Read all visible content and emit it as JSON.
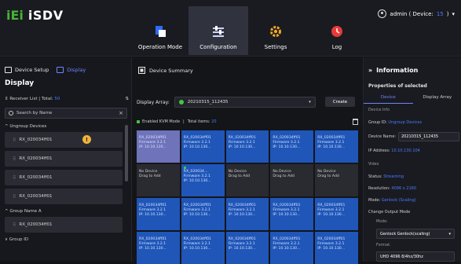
{
  "app": {
    "logo_mark": "iEi",
    "logo_text": "iSDV"
  },
  "nav": [
    {
      "label": "Operation Mode",
      "icon": "operation-mode-icon"
    },
    {
      "label": "Configuration",
      "icon": "configuration-icon"
    },
    {
      "label": "Settings",
      "icon": "gear-icon"
    },
    {
      "label": "Log",
      "icon": "log-icon"
    }
  ],
  "user": {
    "prefix": "admin ( Device: ",
    "count": "15",
    "suffix": " )",
    "caret": "▾"
  },
  "left": {
    "tab_device_setup": "Device Setup",
    "tab_display": "Display",
    "title": "Display",
    "receiver_label": "Receiver List",
    "total_label": "Total:",
    "total_value": "50",
    "search_placeholder": "Search by Name",
    "search_clear": "×",
    "group_ungroup": "^ Ungroup Devices",
    "group_a": "^ Group Name A",
    "group_d": "∨ Group ID",
    "devices_top": [
      "RX_020034ff01",
      "RX_020034ff01",
      "RX_020034ff01",
      "RX_020034ff01"
    ],
    "devices_group_a": [
      "RX_020034ff01"
    ],
    "badge": "!"
  },
  "center": {
    "summary_tab": "Device Summary",
    "array_label": "Display Array:",
    "array_value": "20210315_112435",
    "create_label": "Create",
    "kvm_label": "Enabled KVM Mode",
    "kvm_sep": "|",
    "kvm_total_label": "Total items:",
    "kvm_total_value": "20",
    "cells": [
      {
        "type": "selected",
        "l1": "RX_020034ff01",
        "l2": "Firmware 3.2.1",
        "l3": "IP: 10.10.130..."
      },
      {
        "type": "device",
        "l1": "RX_020034ff01",
        "l2": "Firmware 3.2.1",
        "l3": "IP: 10.10.130..."
      },
      {
        "type": "device",
        "l1": "RX_020034ff01",
        "l2": "Firmware 3.2.1",
        "l3": "IP: 10.10.130..."
      },
      {
        "type": "device",
        "l1": "RX_020034ff01",
        "l2": "Firmware 3.2.1",
        "l3": "IP: 10.10.130..."
      },
      {
        "type": "device",
        "l1": "RX_020034ff01",
        "l2": "Firmware 3.2.1",
        "l3": "IP: 10.10.130..."
      },
      {
        "type": "empty",
        "l1": "No Device",
        "l2": "Drag to Add",
        "l3": ""
      },
      {
        "type": "kvm",
        "l1": "RX_020034...",
        "l2": "Firmware 3.2.1",
        "l3": "IP: 10.10.130..."
      },
      {
        "type": "empty",
        "l1": "No Device",
        "l2": "Drag to Add",
        "l3": ""
      },
      {
        "type": "empty",
        "l1": "No Device",
        "l2": "Drag to Add",
        "l3": ""
      },
      {
        "type": "empty",
        "l1": "No Device",
        "l2": "Drag to Add",
        "l3": ""
      },
      {
        "type": "device",
        "l1": "RX_020034ff01",
        "l2": "Firmware 3.2.1",
        "l3": "IP: 10.10.130..."
      },
      {
        "type": "device",
        "l1": "RX_020034ff01",
        "l2": "Firmware 3.2.1",
        "l3": "IP: 10.10.130..."
      },
      {
        "type": "device",
        "l1": "RX_020034ff01",
        "l2": "Firmware 3.2.1",
        "l3": "IP: 10.10.130..."
      },
      {
        "type": "device",
        "l1": "RX_020034ff01",
        "l2": "Firmware 3.2.1",
        "l3": "IP: 10.10.130..."
      },
      {
        "type": "device",
        "l1": "RX_020034ff01",
        "l2": "Firmware 3.2.1",
        "l3": "IP: 10.10.130..."
      },
      {
        "type": "device",
        "l1": "RX_020034ff01",
        "l2": "Firmware 3.2.1",
        "l3": "IP: 10.10.130..."
      },
      {
        "type": "device",
        "l1": "RX_020034ff01",
        "l2": "Firmware 3.2.1",
        "l3": "IP: 10.10.130..."
      },
      {
        "type": "device",
        "l1": "RX_020034ff01",
        "l2": "Firmware 3.2.1",
        "l3": "IP: 10.10.130..."
      },
      {
        "type": "device",
        "l1": "RX_020034ff01",
        "l2": "Firmware 3.2.1",
        "l3": "IP: 10.10.130..."
      },
      {
        "type": "device",
        "l1": "RX_020034ff01",
        "l2": "Firmware 3.2.1",
        "l3": "IP: 10.10.130..."
      }
    ]
  },
  "right": {
    "title_arrow": "»",
    "title": "Information",
    "props_title": "Properties of selected",
    "tab_device": "Device",
    "tab_display_array": "Display Array",
    "device_info_label": "Device Info",
    "group_id_label": "Group ID:",
    "group_id_value": "Ungroup Devices",
    "device_name_label": "Device Name:",
    "device_name_value": "20210315_112435",
    "ip_label": "IP Address:",
    "ip_value": "10.10.130.104",
    "video_label": "Video",
    "status_label": "Status:",
    "status_value": "Streaming",
    "resolution_label": "Resolution:",
    "resolution_value": "4096 x 2160",
    "mode_label": "Mode:",
    "mode_value": "Genlock (Scaling)",
    "change_output_label": "Change Output Mode",
    "mode_select_label": "Mode:",
    "mode_select_value": "Genlock Genlock(scaling)",
    "format_label": "Format:",
    "format_value": "UHD 4096 8/4hz/30hz"
  },
  "colors": {
    "accent": "#6b86ff",
    "link": "#4a7bff",
    "tile": "#1f56b8",
    "success": "#46c546",
    "brand": "#46b336"
  }
}
